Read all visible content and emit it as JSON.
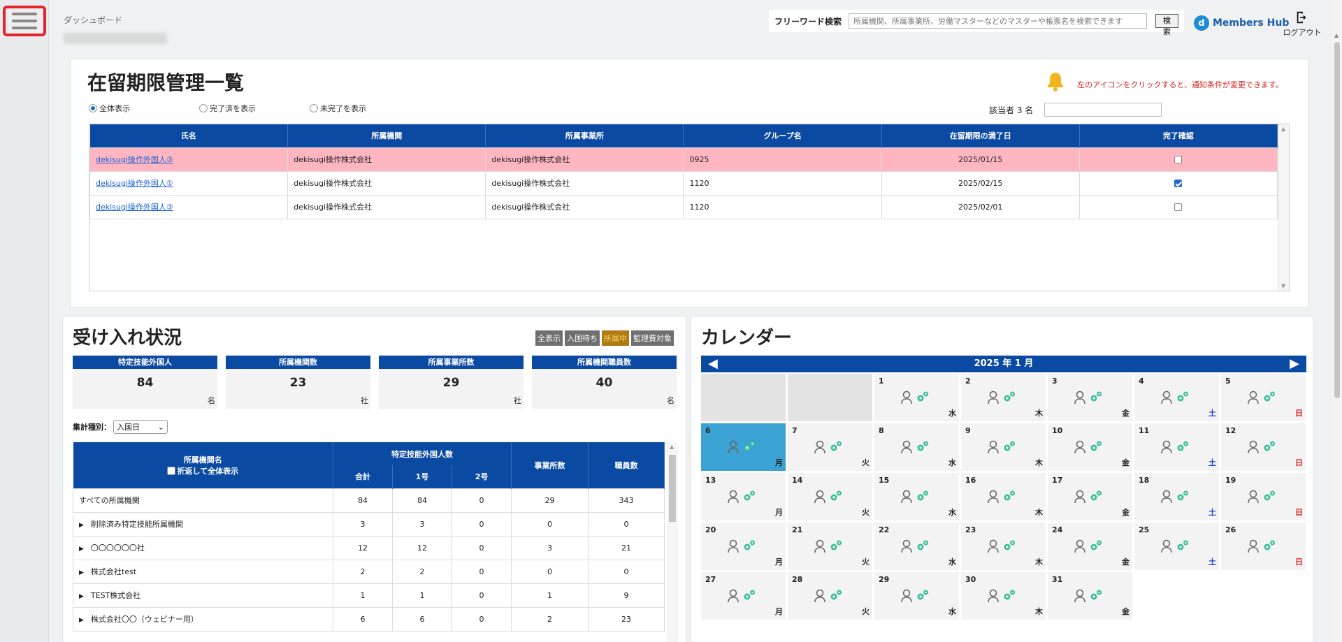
{
  "header": {
    "breadcrumb": "ダッシュボード",
    "search_label": "フリーワード検索",
    "search_placeholder": "所属機関、所属事業所、労働マスターなどのマスターや帳票名を検索できます",
    "search_button": "検索",
    "brand": "Members Hub",
    "logout": "ログアウト"
  },
  "residence": {
    "title": "在留期限管理一覧",
    "notice": "左のアイコンをクリックすると、通知条件が変更できます。",
    "radios": [
      "全体表示",
      "完了済を表示",
      "未完了を表示"
    ],
    "count_label": "該当者 3 名",
    "columns": [
      "氏名",
      "所属機関",
      "所属事業所",
      "グループ名",
      "在留期限の満了日",
      "完了確認"
    ],
    "rows": [
      {
        "name": "dekisugi操作外国人③",
        "org": "dekisugi操作株式会社",
        "office": "dekisugi操作株式会社",
        "group": "0925",
        "expiry": "2025/01/15",
        "done": false,
        "alert": true
      },
      {
        "name": "dekisugi操作外国人①",
        "org": "dekisugi操作株式会社",
        "office": "dekisugi操作株式会社",
        "group": "1120",
        "expiry": "2025/02/15",
        "done": true,
        "alert": false
      },
      {
        "name": "dekisugi操作外国人③",
        "org": "dekisugi操作株式会社",
        "office": "dekisugi操作株式会社",
        "group": "1120",
        "expiry": "2025/02/01",
        "done": false,
        "alert": false
      }
    ]
  },
  "intake": {
    "title": "受け入れ状況",
    "filters": [
      "全表示",
      "入国待ち",
      "所属中",
      "監理費対象"
    ],
    "active_filter": "所属中",
    "stats": [
      {
        "label": "特定技能外国人",
        "value": "84",
        "unit": "名"
      },
      {
        "label": "所属機関数",
        "value": "23",
        "unit": "社"
      },
      {
        "label": "所属事業所数",
        "value": "29",
        "unit": "社"
      },
      {
        "label": "所属機関職員数",
        "value": "40",
        "unit": "名"
      }
    ],
    "agg_label": "集計種別：",
    "agg_value": "入国日",
    "table_headers": {
      "org": "所属機関名",
      "wrap_toggle": "折返して全体表示",
      "foreign_count": "特定技能外国人数",
      "total": "合計",
      "type1": "1号",
      "type2": "2号",
      "offices": "事業所数",
      "staff": "職員数"
    },
    "rows": [
      {
        "name": "すべての所属機関",
        "expand": false,
        "total": "84",
        "t1": "84",
        "t2": "0",
        "offices": "29",
        "staff": "343"
      },
      {
        "name": "削除済み特定技能所属機関",
        "expand": true,
        "total": "3",
        "t1": "3",
        "t2": "0",
        "offices": "0",
        "staff": "0"
      },
      {
        "name": "〇〇〇〇〇〇社",
        "expand": true,
        "total": "12",
        "t1": "12",
        "t2": "0",
        "offices": "3",
        "staff": "21"
      },
      {
        "name": "株式会社test",
        "expand": true,
        "total": "2",
        "t1": "2",
        "t2": "0",
        "offices": "0",
        "staff": "0"
      },
      {
        "name": "TEST株式会社",
        "expand": true,
        "total": "1",
        "t1": "1",
        "t2": "0",
        "offices": "1",
        "staff": "9"
      },
      {
        "name": "株式会社〇〇（ウェビナー用）",
        "expand": true,
        "total": "6",
        "t1": "6",
        "t2": "0",
        "offices": "2",
        "staff": "23"
      }
    ]
  },
  "calendar": {
    "title": "カレンダー",
    "month_label": "2025 年 1 月",
    "leading_blank_days": 2,
    "days": [
      {
        "d": "1",
        "wd": "水"
      },
      {
        "d": "2",
        "wd": "木"
      },
      {
        "d": "3",
        "wd": "金"
      },
      {
        "d": "4",
        "wd": "土"
      },
      {
        "d": "5",
        "wd": "日"
      },
      {
        "d": "6",
        "wd": "月",
        "today": true
      },
      {
        "d": "7",
        "wd": "火"
      },
      {
        "d": "8",
        "wd": "水"
      },
      {
        "d": "9",
        "wd": "木"
      },
      {
        "d": "10",
        "wd": "金"
      },
      {
        "d": "11",
        "wd": "土"
      },
      {
        "d": "12",
        "wd": "日"
      },
      {
        "d": "13",
        "wd": "月"
      },
      {
        "d": "14",
        "wd": "火"
      },
      {
        "d": "15",
        "wd": "水"
      },
      {
        "d": "16",
        "wd": "木"
      },
      {
        "d": "17",
        "wd": "金"
      },
      {
        "d": "18",
        "wd": "土"
      },
      {
        "d": "19",
        "wd": "日"
      },
      {
        "d": "20",
        "wd": "月"
      },
      {
        "d": "21",
        "wd": "火"
      },
      {
        "d": "22",
        "wd": "水"
      },
      {
        "d": "23",
        "wd": "木"
      },
      {
        "d": "24",
        "wd": "金"
      },
      {
        "d": "25",
        "wd": "土"
      },
      {
        "d": "26",
        "wd": "日"
      },
      {
        "d": "27",
        "wd": "月"
      },
      {
        "d": "28",
        "wd": "火"
      },
      {
        "d": "29",
        "wd": "水"
      },
      {
        "d": "30",
        "wd": "木"
      },
      {
        "d": "31",
        "wd": "金"
      }
    ]
  },
  "colors": {
    "primary": "#0b4aa2",
    "alert_row": "#ffb6c1",
    "today": "#3aa3d4",
    "hamburger_highlight": "#e0262c"
  }
}
